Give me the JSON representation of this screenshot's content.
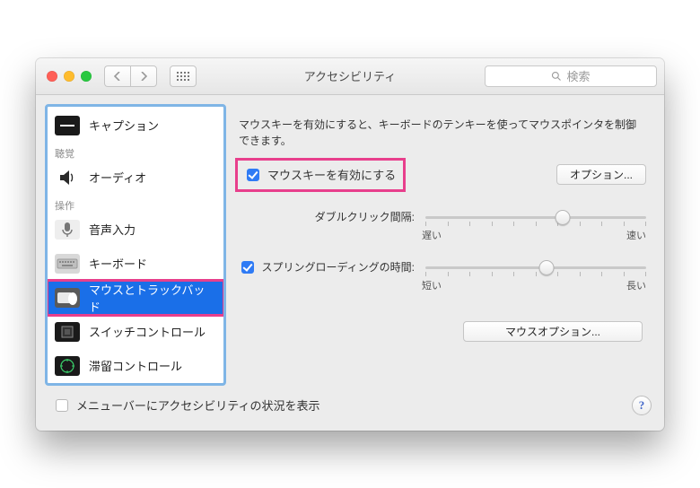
{
  "window": {
    "title": "アクセシビリティ",
    "search_placeholder": "検索"
  },
  "sidebar": {
    "groups": [
      {
        "label": "",
        "items": [
          {
            "id": "captions",
            "label": "キャプション"
          }
        ]
      },
      {
        "label": "聴覚",
        "items": [
          {
            "id": "audio",
            "label": "オーディオ"
          }
        ]
      },
      {
        "label": "操作",
        "items": [
          {
            "id": "dictation",
            "label": "音声入力"
          },
          {
            "id": "keyboard",
            "label": "キーボード"
          },
          {
            "id": "mouse-trackpad",
            "label": "マウスとトラックバッド",
            "selected": true
          },
          {
            "id": "switch-control",
            "label": "スイッチコントロール"
          },
          {
            "id": "dwell-control",
            "label": "滞留コントロール"
          }
        ]
      }
    ]
  },
  "main": {
    "intro": "マウスキーを有効にすると、キーボードのテンキーを使ってマウスポインタを制御できます。",
    "enable_mouse_keys_label": "マウスキーを有効にする",
    "enable_mouse_keys_checked": true,
    "options_button": "オプション...",
    "double_click_label": "ダブルクリック間隔:",
    "double_click_min": "遅い",
    "double_click_max": "速い",
    "double_click_value_pct": 62,
    "spring_label": "スプリングローディングの時間:",
    "spring_checked": true,
    "spring_min": "短い",
    "spring_max": "長い",
    "spring_value_pct": 55,
    "mouse_options_button": "マウスオプション..."
  },
  "footer": {
    "show_status_label": "メニューバーにアクセシビリティの状況を表示",
    "show_status_checked": false
  }
}
